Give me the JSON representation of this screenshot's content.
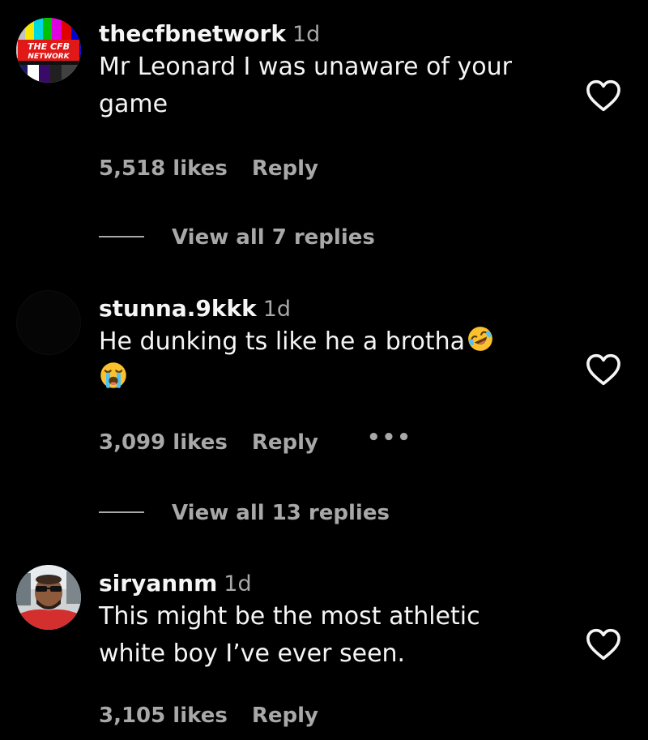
{
  "comments": [
    {
      "username": "thecfbnetwork",
      "time": "1d",
      "text_lines": [
        "Mr Leonard I was unaware of your",
        "game"
      ],
      "likes": "5,518 likes",
      "reply_label": "Reply",
      "view_replies": "View all 7 replies",
      "avatar_text": [
        "THE CFB",
        "NETWORK"
      ]
    },
    {
      "username": "stunna.9kkk",
      "time": "1d",
      "text_line1": "He dunking ts like he a brotha",
      "emoji_1": "rolling-on-floor-laughing-emoji",
      "emoji_2": "loudly-crying-face-emoji",
      "likes": "3,099 likes",
      "reply_label": "Reply",
      "more_label": "•••",
      "view_replies": "View all 13 replies"
    },
    {
      "username": "siryannm",
      "time": "1d",
      "text_lines": [
        "This might be the most athletic",
        "white boy I’ve ever seen."
      ],
      "likes": "3,105 likes",
      "reply_label": "Reply"
    }
  ],
  "colors": {
    "background": "#000000",
    "primary_text": "#f5f5f5",
    "secondary_text": "#a8a8a8",
    "emoji_yellow": "#fbc02d"
  },
  "icons": {
    "like": "heart-outline-icon"
  }
}
